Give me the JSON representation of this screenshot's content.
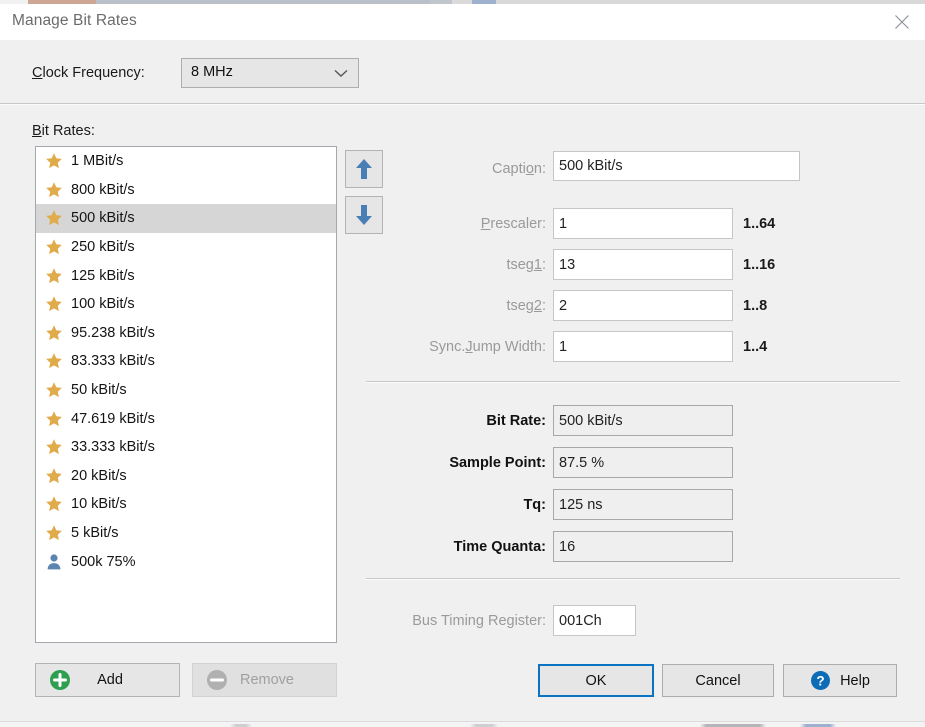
{
  "window": {
    "title": "Manage Bit Rates",
    "close_icon": "close-icon"
  },
  "colors": {
    "accent": "#0c73c2",
    "star": "#e0ab4a",
    "user": "#5b84b1",
    "add": "#2e9e4f",
    "remove_disabled": "#b0b0b0",
    "dialog_bg": "#f0f0f0",
    "selection": "#d6d6d6"
  },
  "clock": {
    "label": "Clock Frequency:",
    "label_pre": "C",
    "label_post": "lock Frequency:",
    "value": "8 MHz",
    "arrow_icon": "chevron-down-icon"
  },
  "bitrates": {
    "label": "Bit Rates:",
    "label_pre": "B",
    "label_post": "it Rates:",
    "selected_index": 2,
    "items": [
      {
        "label": "1 MBit/s",
        "icon": "star-icon"
      },
      {
        "label": "800 kBit/s",
        "icon": "star-icon"
      },
      {
        "label": "500 kBit/s",
        "icon": "star-icon"
      },
      {
        "label": "250 kBit/s",
        "icon": "star-icon"
      },
      {
        "label": "125 kBit/s",
        "icon": "star-icon"
      },
      {
        "label": "100 kBit/s",
        "icon": "star-icon"
      },
      {
        "label": "95.238 kBit/s",
        "icon": "star-icon"
      },
      {
        "label": "83.333 kBit/s",
        "icon": "star-icon"
      },
      {
        "label": "50 kBit/s",
        "icon": "star-icon"
      },
      {
        "label": "47.619 kBit/s",
        "icon": "star-icon"
      },
      {
        "label": "33.333 kBit/s",
        "icon": "star-icon"
      },
      {
        "label": "20 kBit/s",
        "icon": "star-icon"
      },
      {
        "label": "10 kBit/s",
        "icon": "star-icon"
      },
      {
        "label": "5 kBit/s",
        "icon": "star-icon"
      },
      {
        "label": "500k 75%",
        "icon": "user-icon"
      }
    ]
  },
  "reorder": {
    "move_up_icon": "arrow-up-icon",
    "move_down_icon": "arrow-down-icon"
  },
  "list_actions": {
    "add_label": "Add",
    "add_icon": "plus-circle-icon",
    "remove_label": "Remove",
    "remove_icon": "minus-circle-icon",
    "remove_enabled": false
  },
  "editor": {
    "caption": {
      "label": "Caption:",
      "value": "500 kBit/s"
    },
    "fields": [
      {
        "label": "Prescaler:",
        "value": "1",
        "range": "1..64"
      },
      {
        "label": "tseg1:",
        "value": "13",
        "range": "1..16"
      },
      {
        "label": "tseg2:",
        "value": "2",
        "range": "1..8"
      },
      {
        "label": "Sync.Jump Width:",
        "value": "1",
        "range": "1..4"
      }
    ]
  },
  "results": [
    {
      "label": "Bit Rate:",
      "value": "500 kBit/s"
    },
    {
      "label": "Sample Point:",
      "value": "87.5 %"
    },
    {
      "label": "Tq:",
      "value": "125 ns"
    },
    {
      "label": "Time Quanta:",
      "value": "16"
    }
  ],
  "register": {
    "label": "Bus Timing Register:",
    "value": "001Ch"
  },
  "buttons": {
    "ok": "OK",
    "cancel": "Cancel",
    "help": "Help",
    "help_icon": "question-circle-icon"
  }
}
